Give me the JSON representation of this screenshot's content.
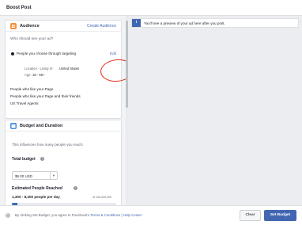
{
  "header": {
    "title": "Boost Post"
  },
  "audience": {
    "title": "Audience",
    "create_link": "Create Audience",
    "question": "Who should see your ad?",
    "option_targeting": "People you choose through targeting",
    "edit": "Edit",
    "location_label": "Location - Living In:",
    "location_value": "United States",
    "age_label": "Age:",
    "age_value": "18 - 65+",
    "option_likes": "People who like your Page",
    "option_likes_friends": "People who like your Page and their friends",
    "option_travel": "US Travel Agents"
  },
  "budget": {
    "title": "Budget and Duration",
    "subtitle": "This influences how many people you reach.",
    "total_label": "Total budget",
    "total_value": "$5.00 USD",
    "reach_label": "Estimated People Reached",
    "reach_value": "1,300 - 8,300 people per day",
    "reach_max": "of 130,000,000",
    "reach_fraction": 0.05
  },
  "preview": {
    "notice": "You'll see a preview of your ad here after you post."
  },
  "footer": {
    "legal_prefix": "By clicking Set Budget, you agree to Facebook's",
    "terms_link": "Terms & Conditions",
    "separator": "|",
    "help_link": "Help Center",
    "clear_button": "Clear",
    "set_button": "Set Budget"
  },
  "colors": {
    "brand": "#4267b2",
    "audience_icon": "#f7923b",
    "budget_icon": "#4a90e2",
    "annotation": "#e0301e"
  }
}
